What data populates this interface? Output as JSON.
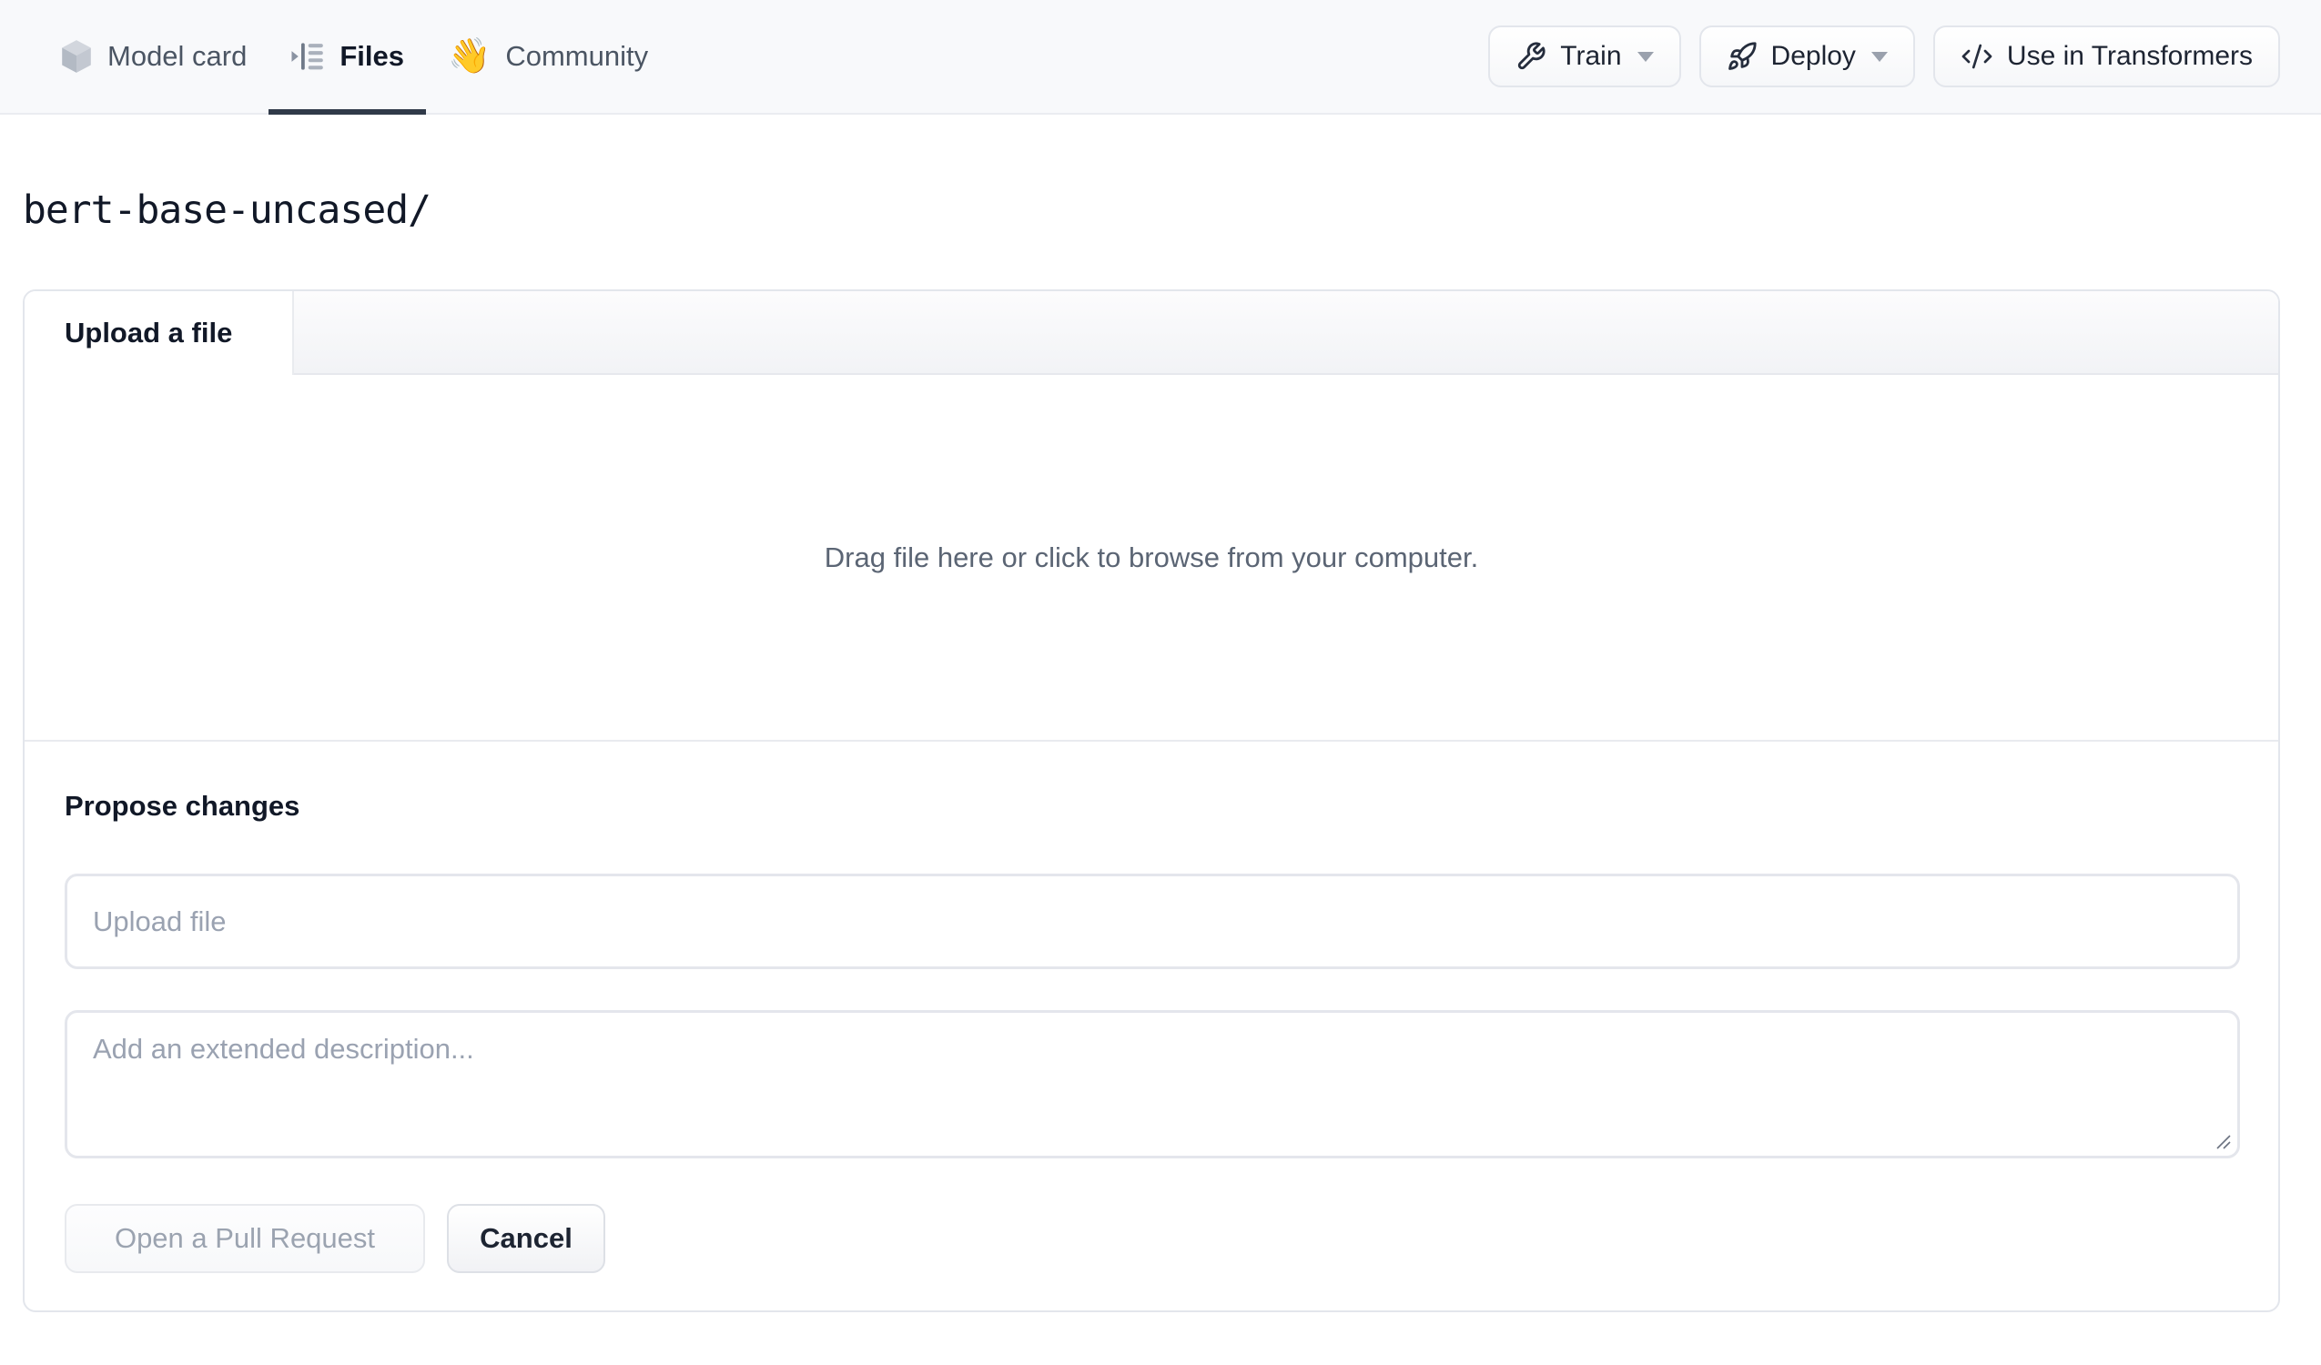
{
  "nav": {
    "tabs": [
      {
        "label": "Model card",
        "icon": "cube-icon",
        "active": false
      },
      {
        "label": "Files",
        "icon": "list-tree-icon",
        "active": true
      },
      {
        "label": "Community",
        "icon": "waving-hand-emoji",
        "emoji": "👋",
        "active": false
      }
    ],
    "actions": {
      "train_label": "Train",
      "deploy_label": "Deploy",
      "use_in_transformers_label": "Use in Transformers",
      "train_icon": "wrench-icon",
      "deploy_icon": "rocket-icon",
      "use_icon": "code-icon"
    }
  },
  "breadcrumb": {
    "path": "bert-base-uncased/"
  },
  "upload_panel": {
    "tab_label": "Upload a file",
    "dropzone_text": "Drag file here or click to browse from your computer.",
    "propose": {
      "heading": "Propose changes",
      "filename_placeholder": "Upload file",
      "filename_value": "",
      "description_placeholder": "Add an extended description...",
      "description_value": "",
      "open_pr_label": "Open a Pull Request",
      "cancel_label": "Cancel"
    }
  },
  "colors": {
    "nav_bg": "#f8f9fb",
    "active_tab_underline": "#303a49",
    "border": "#e3e6ec",
    "muted_text": "#5b6574",
    "placeholder_text": "#9aa2b1",
    "disabled_button_text": "#9ba3b0",
    "dark_text": "#111827"
  }
}
